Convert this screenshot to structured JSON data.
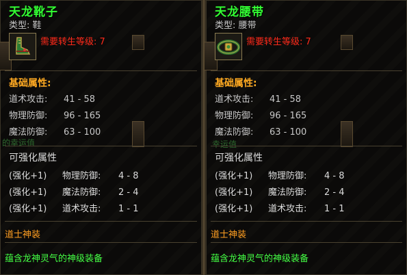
{
  "items": [
    {
      "name": "天龙靴子",
      "type": "类型: 鞋",
      "requirement": "需要转生等级: 7",
      "icon": "boots-icon",
      "basic_title": "基础属性:",
      "attributes": [
        {
          "label": "道术攻击:",
          "value": "41 - 58"
        },
        {
          "label": "物理防御:",
          "value": "96 - 165"
        },
        {
          "label": "魔法防御:",
          "value": "63 - 100"
        }
      ],
      "faded_text": "的幸运值",
      "enhance_title": "可强化属性",
      "enhancements": [
        {
          "level": "(强化+1)",
          "name": "物理防御:",
          "range": "4 - 8"
        },
        {
          "level": "(强化+1)",
          "name": "魔法防御:",
          "range": "2 - 4"
        },
        {
          "level": "(强化+1)",
          "name": "道术攻击:",
          "range": "1 - 1"
        }
      ],
      "set_label": "道士神装",
      "description": "蕴含龙神灵气的神级装备"
    },
    {
      "name": "天龙腰带",
      "type": "类型: 腰带",
      "requirement": "需要转生等级: 7",
      "icon": "belt-icon",
      "basic_title": "基础属性:",
      "attributes": [
        {
          "label": "道术攻击:",
          "value": "41 - 58"
        },
        {
          "label": "物理防御:",
          "value": "96 - 165"
        },
        {
          "label": "魔法防御:",
          "value": "63 - 100"
        }
      ],
      "faded_text": "幸运值",
      "enhance_title": "可强化属性",
      "enhancements": [
        {
          "level": "(强化+1)",
          "name": "物理防御:",
          "range": "4 - 8"
        },
        {
          "level": "(强化+1)",
          "name": "魔法防御:",
          "range": "2 - 4"
        },
        {
          "level": "(强化+1)",
          "name": "道术攻击:",
          "range": "1 - 1"
        }
      ],
      "set_label": "道士神装",
      "description": "蕴含龙神灵气的神级装备"
    }
  ],
  "colors": {
    "name": "#33ff33",
    "requirement": "#ff2a1a",
    "section_title": "#ffaa22",
    "set_label": "#ff9f22",
    "description": "#44ff44"
  }
}
